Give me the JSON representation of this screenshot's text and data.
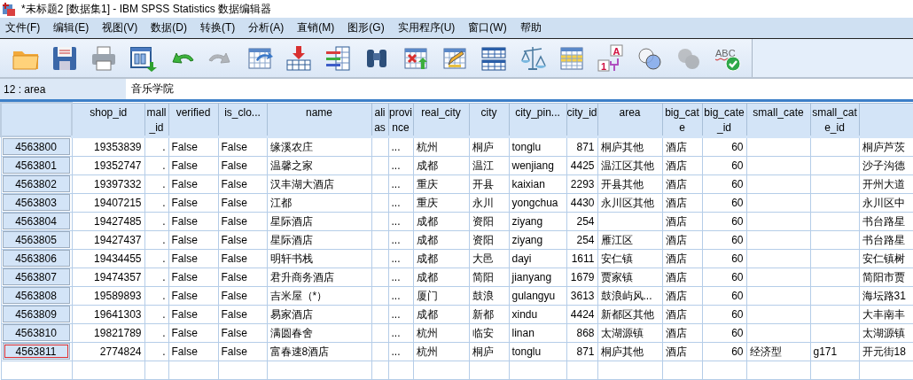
{
  "window": {
    "title": "*未标题2 [数据集1] - IBM SPSS Statistics 数据编辑器"
  },
  "menu": [
    {
      "label": "文件(F)"
    },
    {
      "label": "编辑(E)"
    },
    {
      "label": "视图(V)"
    },
    {
      "label": "数据(D)"
    },
    {
      "label": "转换(T)"
    },
    {
      "label": "分析(A)"
    },
    {
      "label": "直销(M)"
    },
    {
      "label": "图形(G)"
    },
    {
      "label": "实用程序(U)"
    },
    {
      "label": "窗口(W)"
    },
    {
      "label": "帮助"
    }
  ],
  "toolbar": [
    {
      "kind": "folder",
      "disabled": false
    },
    {
      "kind": "save",
      "disabled": false
    },
    {
      "kind": "print",
      "disabled": false
    },
    {
      "kind": "dialog",
      "disabled": false
    },
    {
      "kind": "undo",
      "disabled": false
    },
    {
      "kind": "redo",
      "disabled": true
    },
    {
      "kind": "goto-case",
      "disabled": false
    },
    {
      "kind": "goto-variable",
      "disabled": false
    },
    {
      "kind": "variables",
      "disabled": false
    },
    {
      "kind": "find",
      "disabled": false
    },
    {
      "kind": "insert-cases",
      "disabled": false
    },
    {
      "kind": "insert-variable",
      "disabled": false
    },
    {
      "kind": "split-file",
      "disabled": false
    },
    {
      "kind": "weight",
      "disabled": false
    },
    {
      "kind": "select-cases",
      "disabled": false
    },
    {
      "kind": "value-labels",
      "disabled": false,
      "texts": [
        "A",
        "1"
      ]
    },
    {
      "kind": "use-sets",
      "disabled": false
    },
    {
      "kind": "show-sets",
      "disabled": true
    },
    {
      "kind": "spelling",
      "disabled": false,
      "texts": [
        "ABC"
      ]
    }
  ],
  "cell_editor": {
    "location": "12 : area",
    "value": "音乐学院"
  },
  "table": {
    "columns": [
      {
        "label": "shop_id",
        "kind": "numeric"
      },
      {
        "label": "mall_id",
        "kind": "numeric"
      },
      {
        "label": "verified",
        "kind": "string"
      },
      {
        "label": "is_clo...",
        "kind": "string"
      },
      {
        "label": "name",
        "kind": "string"
      },
      {
        "label": "alias",
        "kind": "string"
      },
      {
        "label": "province",
        "kind": "string"
      },
      {
        "label": "real_city",
        "kind": "string"
      },
      {
        "label": "city",
        "kind": "string"
      },
      {
        "label": "city_pin...",
        "kind": "string"
      },
      {
        "label": "city_id",
        "kind": "numeric"
      },
      {
        "label": "area",
        "kind": "string"
      },
      {
        "label": "big_cate",
        "kind": "string"
      },
      {
        "label": "big_cate_id",
        "kind": "numeric"
      },
      {
        "label": "small_cate",
        "kind": "string"
      },
      {
        "label": "small_cate_id",
        "kind": "string"
      },
      {
        "kind": "string"
      }
    ],
    "rows": [
      {
        "id": "4563800",
        "selected": false,
        "cells": [
          "19353839",
          ".",
          "False",
          "False",
          "缘溪农庄",
          null,
          "...",
          "杭州",
          "桐庐",
          "tonglu",
          "871",
          "桐庐其他",
          "酒店",
          "60",
          null,
          null,
          "桐庐芦茨"
        ]
      },
      {
        "id": "4563801",
        "selected": false,
        "cells": [
          "19352747",
          ".",
          "False",
          "False",
          "温馨之家",
          null,
          "...",
          "成都",
          "温江",
          "wenjiang",
          "4425",
          "温江区其他",
          "酒店",
          "60",
          null,
          null,
          "沙子沟德"
        ]
      },
      {
        "id": "4563802",
        "selected": false,
        "cells": [
          "19397332",
          ".",
          "False",
          "False",
          "汉丰湖大酒店",
          null,
          "...",
          "重庆",
          "开县",
          "kaixian",
          "2293",
          "开县其他",
          "酒店",
          "60",
          null,
          null,
          "开州大道"
        ]
      },
      {
        "id": "4563803",
        "selected": false,
        "cells": [
          "19407215",
          ".",
          "False",
          "False",
          "江都",
          null,
          "...",
          "重庆",
          "永川",
          "yongchua",
          "4430",
          "永川区其他",
          "酒店",
          "60",
          null,
          null,
          "永川区中"
        ]
      },
      {
        "id": "4563804",
        "selected": false,
        "cells": [
          "19427485",
          ".",
          "False",
          "False",
          "星际酒店",
          null,
          "...",
          "成都",
          "资阳",
          "ziyang",
          "254",
          null,
          "酒店",
          "60",
          null,
          null,
          "书台路星"
        ]
      },
      {
        "id": "4563805",
        "selected": false,
        "cells": [
          "19427437",
          ".",
          "False",
          "False",
          "星际酒店",
          null,
          "...",
          "成都",
          "资阳",
          "ziyang",
          "254",
          "雁江区",
          "酒店",
          "60",
          null,
          null,
          "书台路星"
        ]
      },
      {
        "id": "4563806",
        "selected": false,
        "cells": [
          "19434455",
          ".",
          "False",
          "False",
          "明轩书栈",
          null,
          "...",
          "成都",
          "大邑",
          "dayi",
          "1611",
          "安仁镇",
          "酒店",
          "60",
          null,
          null,
          "安仁镇树"
        ]
      },
      {
        "id": "4563807",
        "selected": false,
        "cells": [
          "19474357",
          ".",
          "False",
          "False",
          "君升商务酒店",
          null,
          "...",
          "成都",
          "简阳",
          "jianyang",
          "1679",
          "贾家镇",
          "酒店",
          "60",
          null,
          null,
          "简阳市贾"
        ]
      },
      {
        "id": "4563808",
        "selected": false,
        "cells": [
          "19589893",
          ".",
          "False",
          "False",
          "吉米屋（*）",
          null,
          "...",
          "厦门",
          "鼓浪",
          "gulangyu",
          "3613",
          "鼓浪屿风...",
          "酒店",
          "60",
          null,
          null,
          "海坛路31"
        ]
      },
      {
        "id": "4563809",
        "selected": false,
        "cells": [
          "19641303",
          ".",
          "False",
          "False",
          "易家酒店",
          null,
          "...",
          "成都",
          "新都",
          "xindu",
          "4424",
          "新都区其他",
          "酒店",
          "60",
          null,
          null,
          "大丰南丰"
        ]
      },
      {
        "id": "4563810",
        "selected": false,
        "cells": [
          "19821789",
          ".",
          "False",
          "False",
          "满圆春舍",
          null,
          "...",
          "杭州",
          "临安",
          "linan",
          "868",
          "太湖源镇",
          "酒店",
          "60",
          null,
          null,
          "太湖源镇"
        ]
      },
      {
        "id": "4563811",
        "selected": true,
        "cells": [
          "2774824",
          ".",
          "False",
          "False",
          "富春速8酒店",
          null,
          "...",
          "杭州",
          "桐庐",
          "tonglu",
          "871",
          "桐庐其他",
          "酒店",
          "60",
          "经济型",
          "g171",
          "开元街18"
        ]
      }
    ]
  }
}
